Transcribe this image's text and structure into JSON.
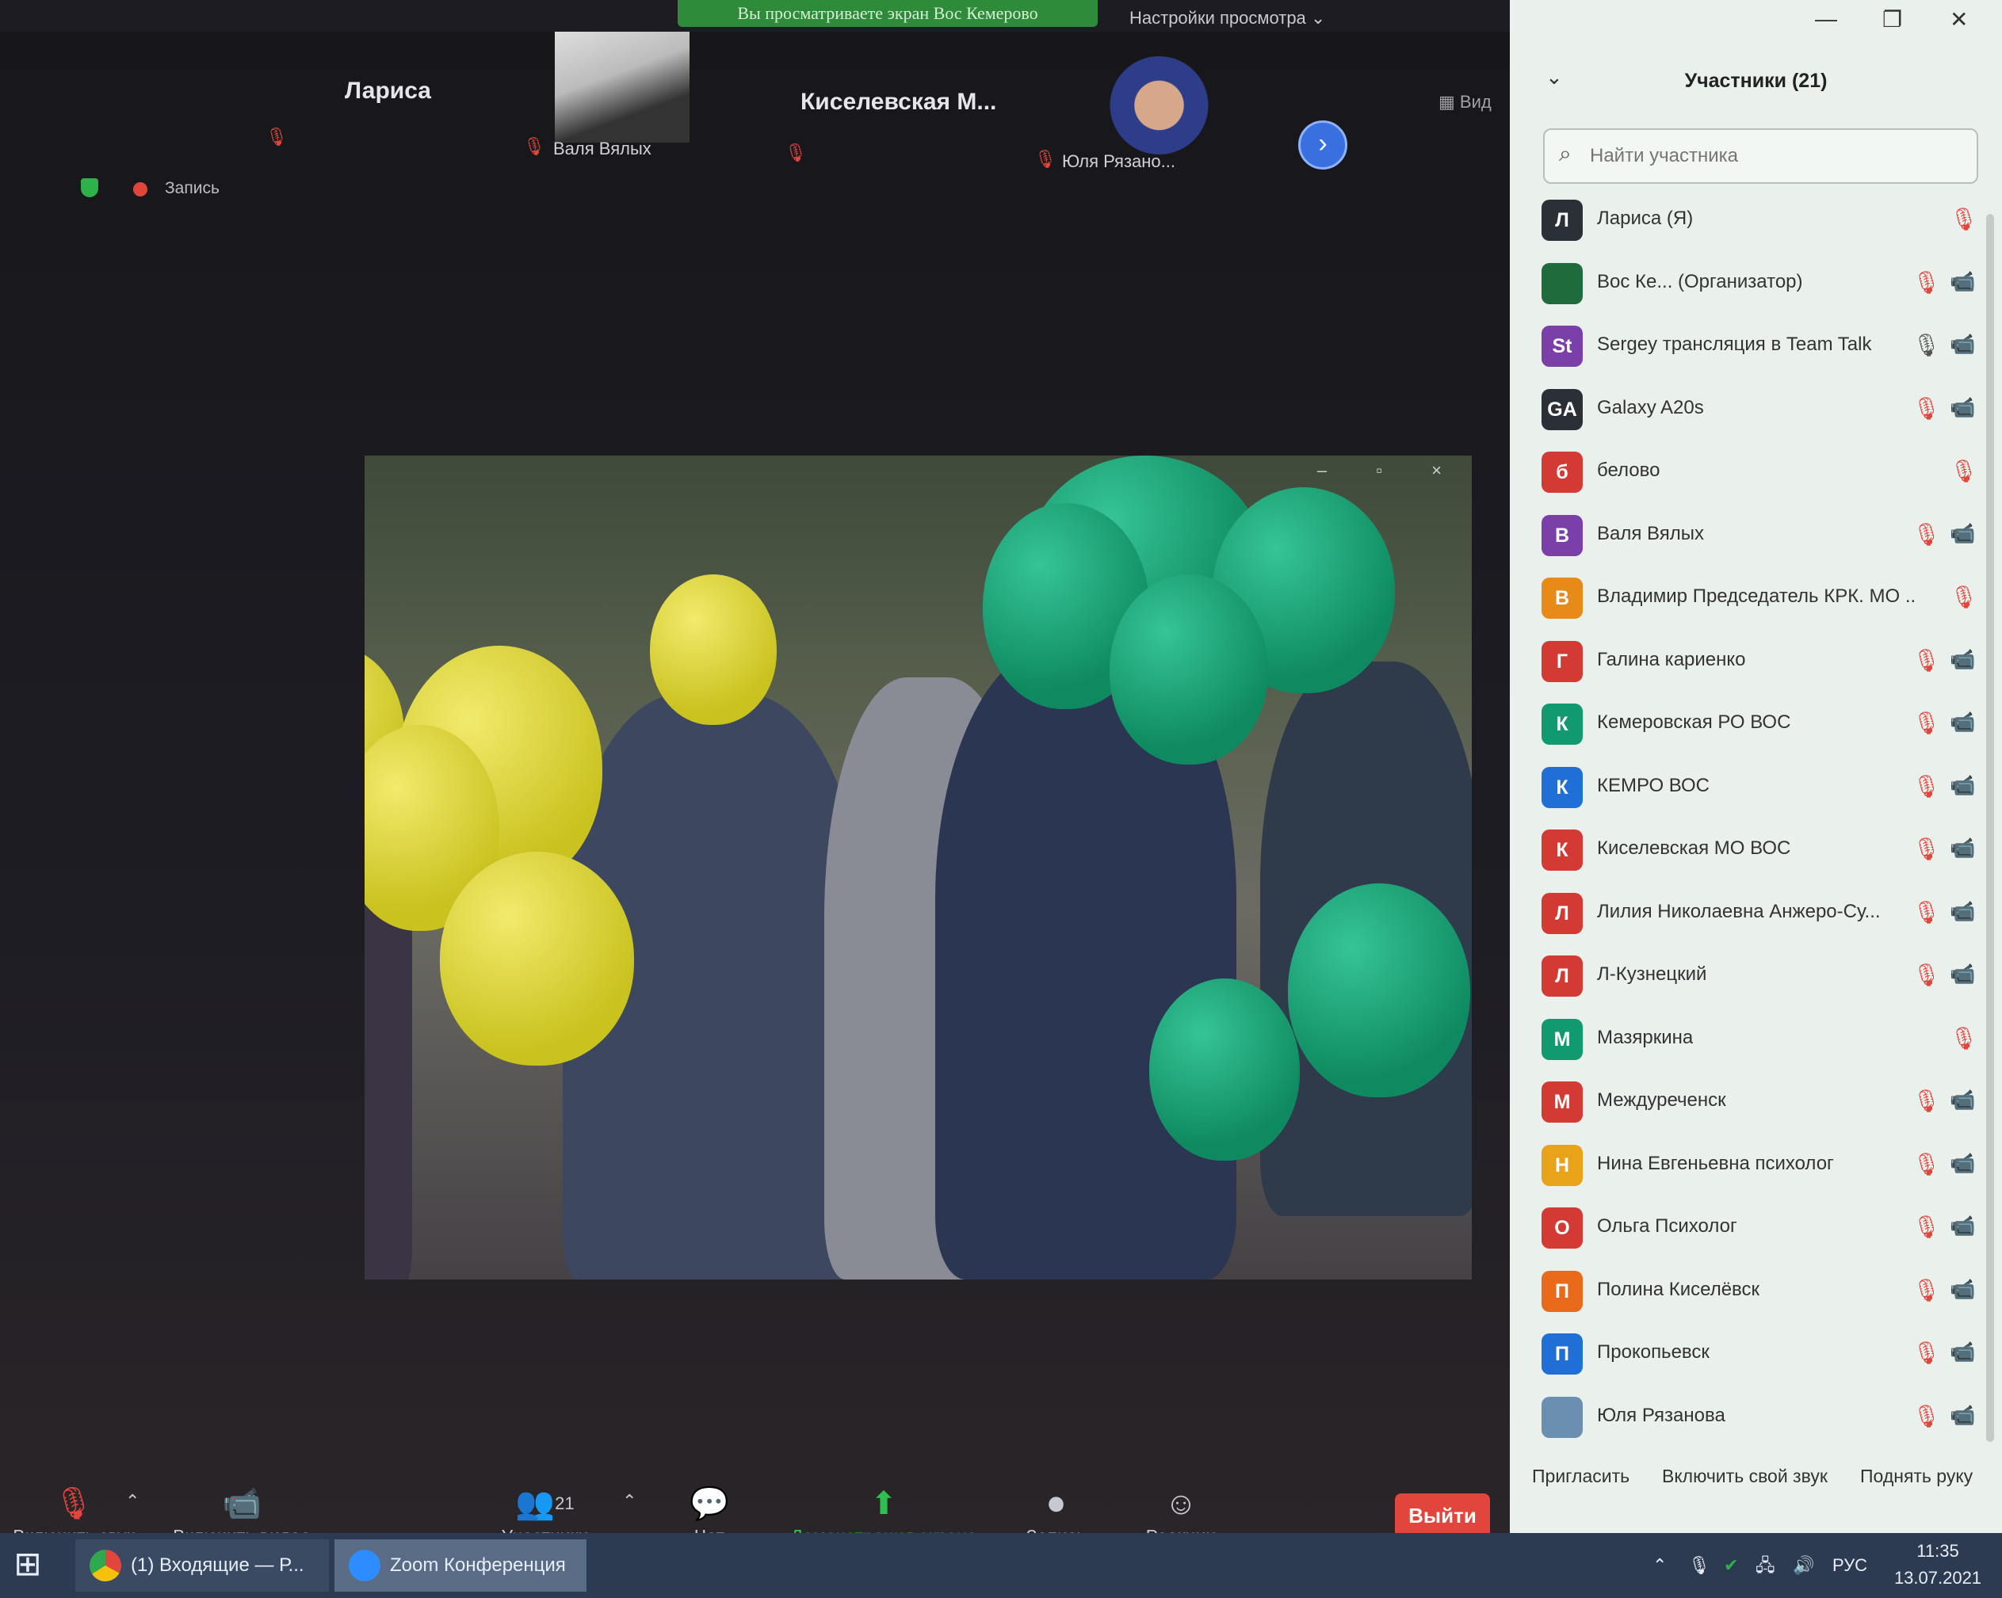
{
  "window": {
    "sharing_banner": "Вы просматриваете экран Вос Кемерово",
    "view_settings": "Настройки просмотра ⌄",
    "controls": {
      "minimize": "—",
      "maximize": "❐",
      "close": "✕"
    }
  },
  "gallery": {
    "tiles": [
      {
        "name": "Лариса"
      },
      {
        "name": "Валя Вялых"
      },
      {
        "name": "Киселевская  М..."
      },
      {
        "name": "Юля Рязано..."
      }
    ],
    "record_label": "Запись",
    "view_label": "Вид",
    "next_glyph": "›"
  },
  "share": {
    "win_controls": "– ▫ ×"
  },
  "toolbar": {
    "unmute": "Включить звук",
    "start_video": "Включить видео",
    "participants_label": "Участники",
    "participants_count": "21",
    "chat": "Чат",
    "share_screen": "Демонстрация экрана",
    "record": "Запись",
    "reactions": "Реакции",
    "leave": "Выйти"
  },
  "panel": {
    "title": "Участники (21)",
    "search_placeholder": "Найти участника",
    "participants": [
      {
        "initials": "Л",
        "name": "Лариса (Я)",
        "color": "#2b2f36",
        "mic": "muted",
        "cam": ""
      },
      {
        "initials": "",
        "name": "Вос Ке...   (Организатор)",
        "color": "#1f6b3b",
        "mic": "muted",
        "cam": "off"
      },
      {
        "initials": "St",
        "name": "Sergey трансляция в Team Talk",
        "color": "#7a3fa8",
        "mic": "on",
        "cam": "off"
      },
      {
        "initials": "GA",
        "name": "Galaxy A20s",
        "color": "#2b2f36",
        "mic": "muted",
        "cam": "off"
      },
      {
        "initials": "б",
        "name": "белово",
        "color": "#d23a33",
        "mic": "muted",
        "cam": ""
      },
      {
        "initials": "В",
        "name": "Валя Вялых",
        "color": "#7a3fa8",
        "mic": "muted",
        "cam": "on"
      },
      {
        "initials": "В",
        "name": "Владимир Председатель КРК. МО ...",
        "color": "#e88a1a",
        "mic": "muted",
        "cam": ""
      },
      {
        "initials": "Г",
        "name": "Галина кариенко",
        "color": "#d23a33",
        "mic": "muted",
        "cam": "off"
      },
      {
        "initials": "К",
        "name": "Кемеровская РО ВОС",
        "color": "#119a6f",
        "mic": "muted",
        "cam": "on"
      },
      {
        "initials": "К",
        "name": "КЕМРО ВОС",
        "color": "#1f6fd6",
        "mic": "muted",
        "cam": "on"
      },
      {
        "initials": "К",
        "name": "Киселевская МО ВОС",
        "color": "#d23a33",
        "mic": "muted",
        "cam": "off"
      },
      {
        "initials": "Л",
        "name": "Лилия Николаевна Анжеро-Су...",
        "color": "#d23a33",
        "mic": "muted",
        "cam": "off"
      },
      {
        "initials": "Л",
        "name": "Л-Кузнецкий",
        "color": "#d23a33",
        "mic": "muted",
        "cam": "off"
      },
      {
        "initials": "М",
        "name": "Мазяркина",
        "color": "#119a6f",
        "mic": "muted",
        "cam": ""
      },
      {
        "initials": "М",
        "name": "Междуреченск",
        "color": "#d23a33",
        "mic": "muted",
        "cam": "on"
      },
      {
        "initials": "Н",
        "name": "Нина Евгеньевна психолог",
        "color": "#e8a31a",
        "mic": "muted",
        "cam": "off"
      },
      {
        "initials": "О",
        "name": "Ольга Психолог",
        "color": "#d23a33",
        "mic": "muted",
        "cam": "off"
      },
      {
        "initials": "П",
        "name": "Полина Киселёвск",
        "color": "#e86a1a",
        "mic": "muted",
        "cam": "off"
      },
      {
        "initials": "П",
        "name": "Прокопьевск",
        "color": "#1f6fd6",
        "mic": "muted",
        "cam": "off"
      },
      {
        "initials": "",
        "name": "Юля Рязанова",
        "color": "#6a8fb0",
        "mic": "muted",
        "cam": "off"
      }
    ],
    "footer": {
      "invite": "Пригласить",
      "unmute_me": "Включить свой звук",
      "raise_hand": "Поднять руку"
    }
  },
  "taskbar": {
    "tasks": [
      {
        "label": "(1) Входящие — Р...",
        "icon": "chrome-icon"
      },
      {
        "label": "Zoom Конференция",
        "icon": "zoom-icon"
      }
    ],
    "lang": "РУС",
    "time": "11:35",
    "date": "13.07.2021"
  }
}
